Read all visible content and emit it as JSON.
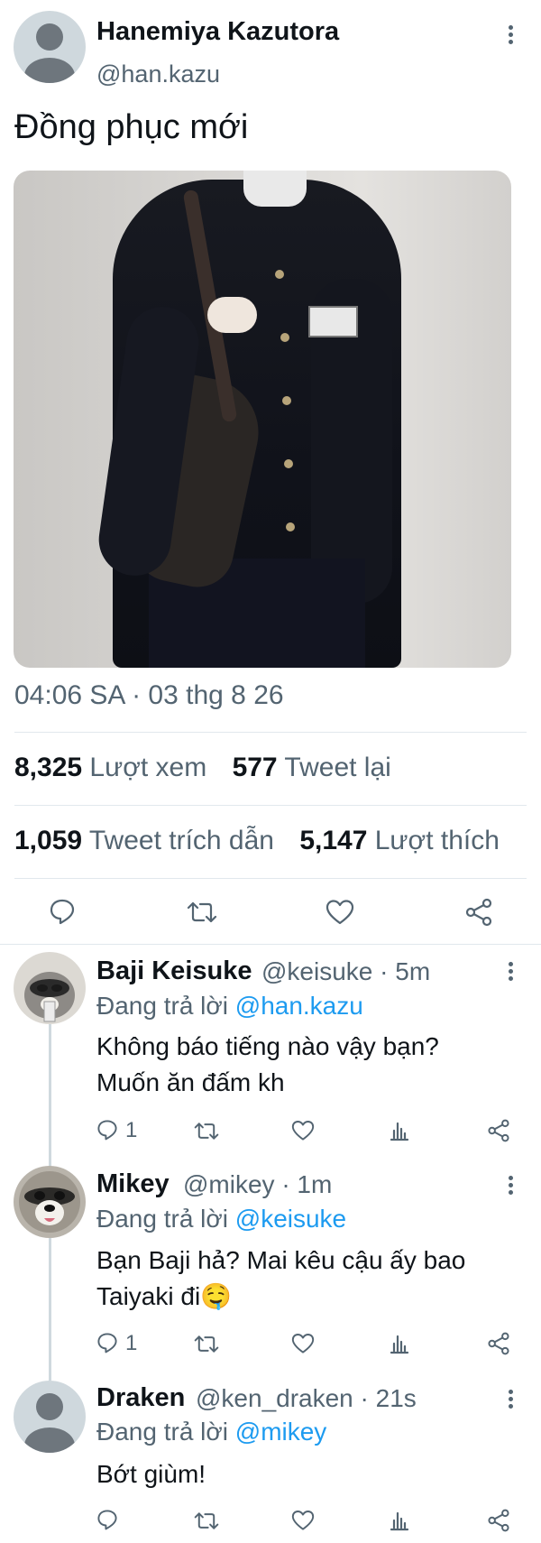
{
  "tweet": {
    "author": {
      "name": "Hanemiya Kazutora",
      "handle": "@han.kazu"
    },
    "text": "Đồng phục mới",
    "timestamp": "04:06 SA · 03 thg 8 26",
    "stats": {
      "views": {
        "value": "8,325",
        "label": "Lượt xem"
      },
      "retweets": {
        "value": "577",
        "label": "Tweet lại"
      },
      "quotes": {
        "value": "1,059",
        "label": "Tweet trích dẫn"
      },
      "likes": {
        "value": "5,147",
        "label": "Lượt thích"
      }
    },
    "actions": [
      "reply-icon",
      "retweet-icon",
      "like-icon",
      "share-icon"
    ]
  },
  "replies": [
    {
      "name": "Baji Keisuke",
      "meta": "@keisuke · 5m",
      "replying_label": "Đang trả lời",
      "mention": "@han.kazu",
      "text_lines": [
        "Không báo tiếng nào vậy bạn?",
        "Muốn ăn đấm kh"
      ],
      "reply_count": "1"
    },
    {
      "name": "Mikey",
      "meta": "@mikey · 1m",
      "replying_label": "Đang trả lời",
      "mention": "@keisuke",
      "text_lines": [
        "Bạn Baji hả? Mai kêu cậu ấy bao",
        "Taiyaki đi🤤"
      ],
      "reply_count": "1"
    },
    {
      "name": "Draken",
      "meta": "@ken_draken · 21s",
      "replying_label": "Đang trả lời",
      "mention": "@mikey",
      "text_lines": [
        "Bớt giùm!"
      ],
      "reply_count": ""
    }
  ],
  "colors": {
    "accent": "#1d9bf0",
    "text": "#0f1419",
    "muted": "#536471",
    "divider": "#e1e8ed"
  }
}
